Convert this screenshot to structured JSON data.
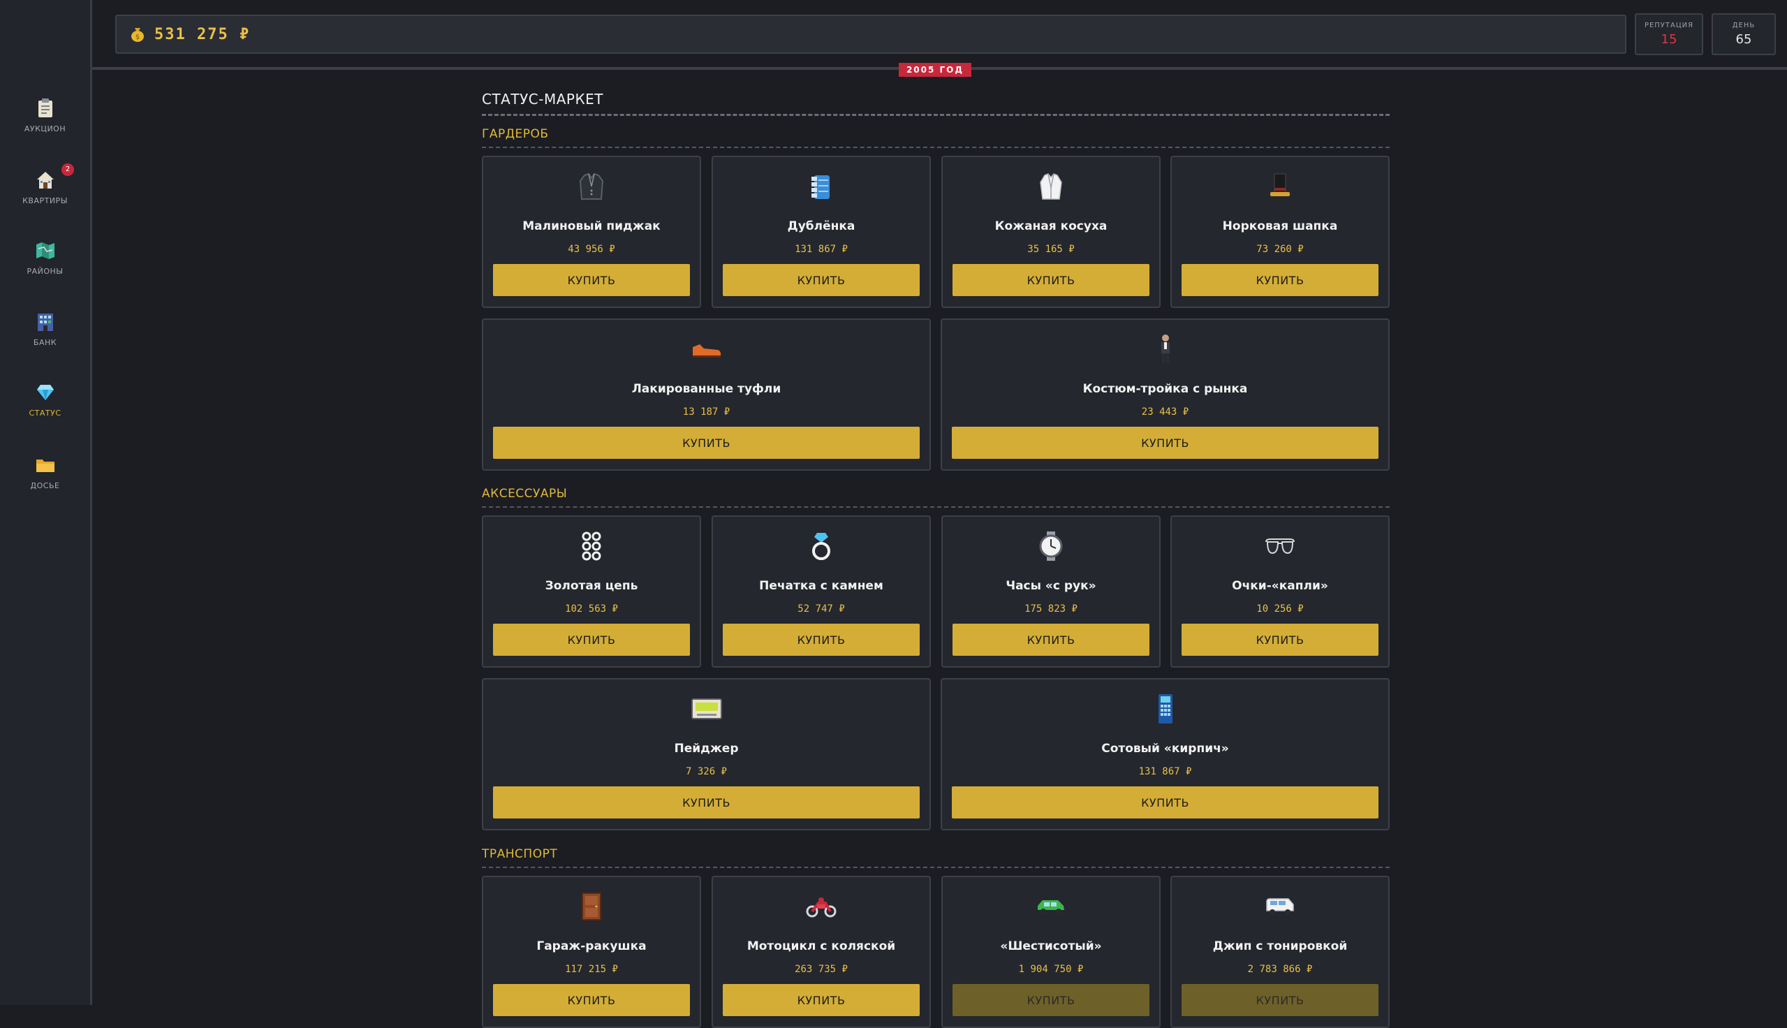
{
  "sidebar": {
    "items": [
      {
        "label": "АУКЦИОН",
        "icon": "clipboard-icon"
      },
      {
        "label": "КВАРТИРЫ",
        "icon": "house-icon",
        "badge": "2"
      },
      {
        "label": "РАЙОНЫ",
        "icon": "map-icon"
      },
      {
        "label": "БАНК",
        "icon": "bank-building-icon"
      },
      {
        "label": "СТАТУС",
        "icon": "diamond-icon",
        "active": true
      },
      {
        "label": "ДОСЬЕ",
        "icon": "folder-icon"
      }
    ]
  },
  "header": {
    "money": "531 275 ₽",
    "reputation_label": "РЕПУТАЦИЯ",
    "reputation_value": "15",
    "day_label": "ДЕНЬ",
    "day_value": "65",
    "year_badge": "2005 ГОД"
  },
  "market": {
    "title": "СТАТУС-МАРКЕТ",
    "buy_label": "КУПИТЬ",
    "sections": [
      {
        "title": "ГАРДЕРОБ",
        "items": [
          {
            "name": "Малиновый пиджак",
            "price": "43 956 ₽",
            "icon": "jacket-icon"
          },
          {
            "name": "Дублёнка",
            "price": "131 867 ₽",
            "icon": "sheepskin-coat-icon"
          },
          {
            "name": "Кожаная косуха",
            "price": "35 165 ₽",
            "icon": "leather-jacket-icon"
          },
          {
            "name": "Норковая шапка",
            "price": "73 260 ₽",
            "icon": "fur-hat-icon"
          },
          {
            "name": "Лакированные туфли",
            "price": "13 187 ₽",
            "icon": "shoe-icon"
          },
          {
            "name": "Костюм-тройка с рынка",
            "price": "23 443 ₽",
            "icon": "suit-icon"
          }
        ]
      },
      {
        "title": "АКСЕССУАРЫ",
        "items": [
          {
            "name": "Золотая цепь",
            "price": "102 563 ₽",
            "icon": "chain-icon"
          },
          {
            "name": "Печатка с камнем",
            "price": "52 747 ₽",
            "icon": "ring-icon"
          },
          {
            "name": "Часы «с рук»",
            "price": "175 823 ₽",
            "icon": "watch-icon"
          },
          {
            "name": "Очки-«капли»",
            "price": "10 256 ₽",
            "icon": "sunglasses-icon"
          },
          {
            "name": "Пейджер",
            "price": "7 326 ₽",
            "icon": "pager-icon"
          },
          {
            "name": "Сотовый «кирпич»",
            "price": "131 867 ₽",
            "icon": "brick-phone-icon"
          }
        ]
      },
      {
        "title": "ТРАНСПОРТ",
        "items": [
          {
            "name": "Гараж-ракушка",
            "price": "117 215 ₽",
            "icon": "garage-icon"
          },
          {
            "name": "Мотоцикл с коляской",
            "price": "263 735 ₽",
            "icon": "motorcycle-icon"
          },
          {
            "name": "«Шестисотый»",
            "price": "1 904 750 ₽",
            "icon": "car-icon",
            "disabled": true
          },
          {
            "name": "Джип с тонировкой",
            "price": "2 783 866 ₽",
            "icon": "jeep-icon",
            "disabled": true
          }
        ]
      }
    ]
  },
  "colors": {
    "accent": "#e0b93a",
    "button": "#d4ad37",
    "button_disabled": "#6e6029",
    "danger": "#c8283c",
    "background": "#1b1d22",
    "card": "#24272d"
  }
}
